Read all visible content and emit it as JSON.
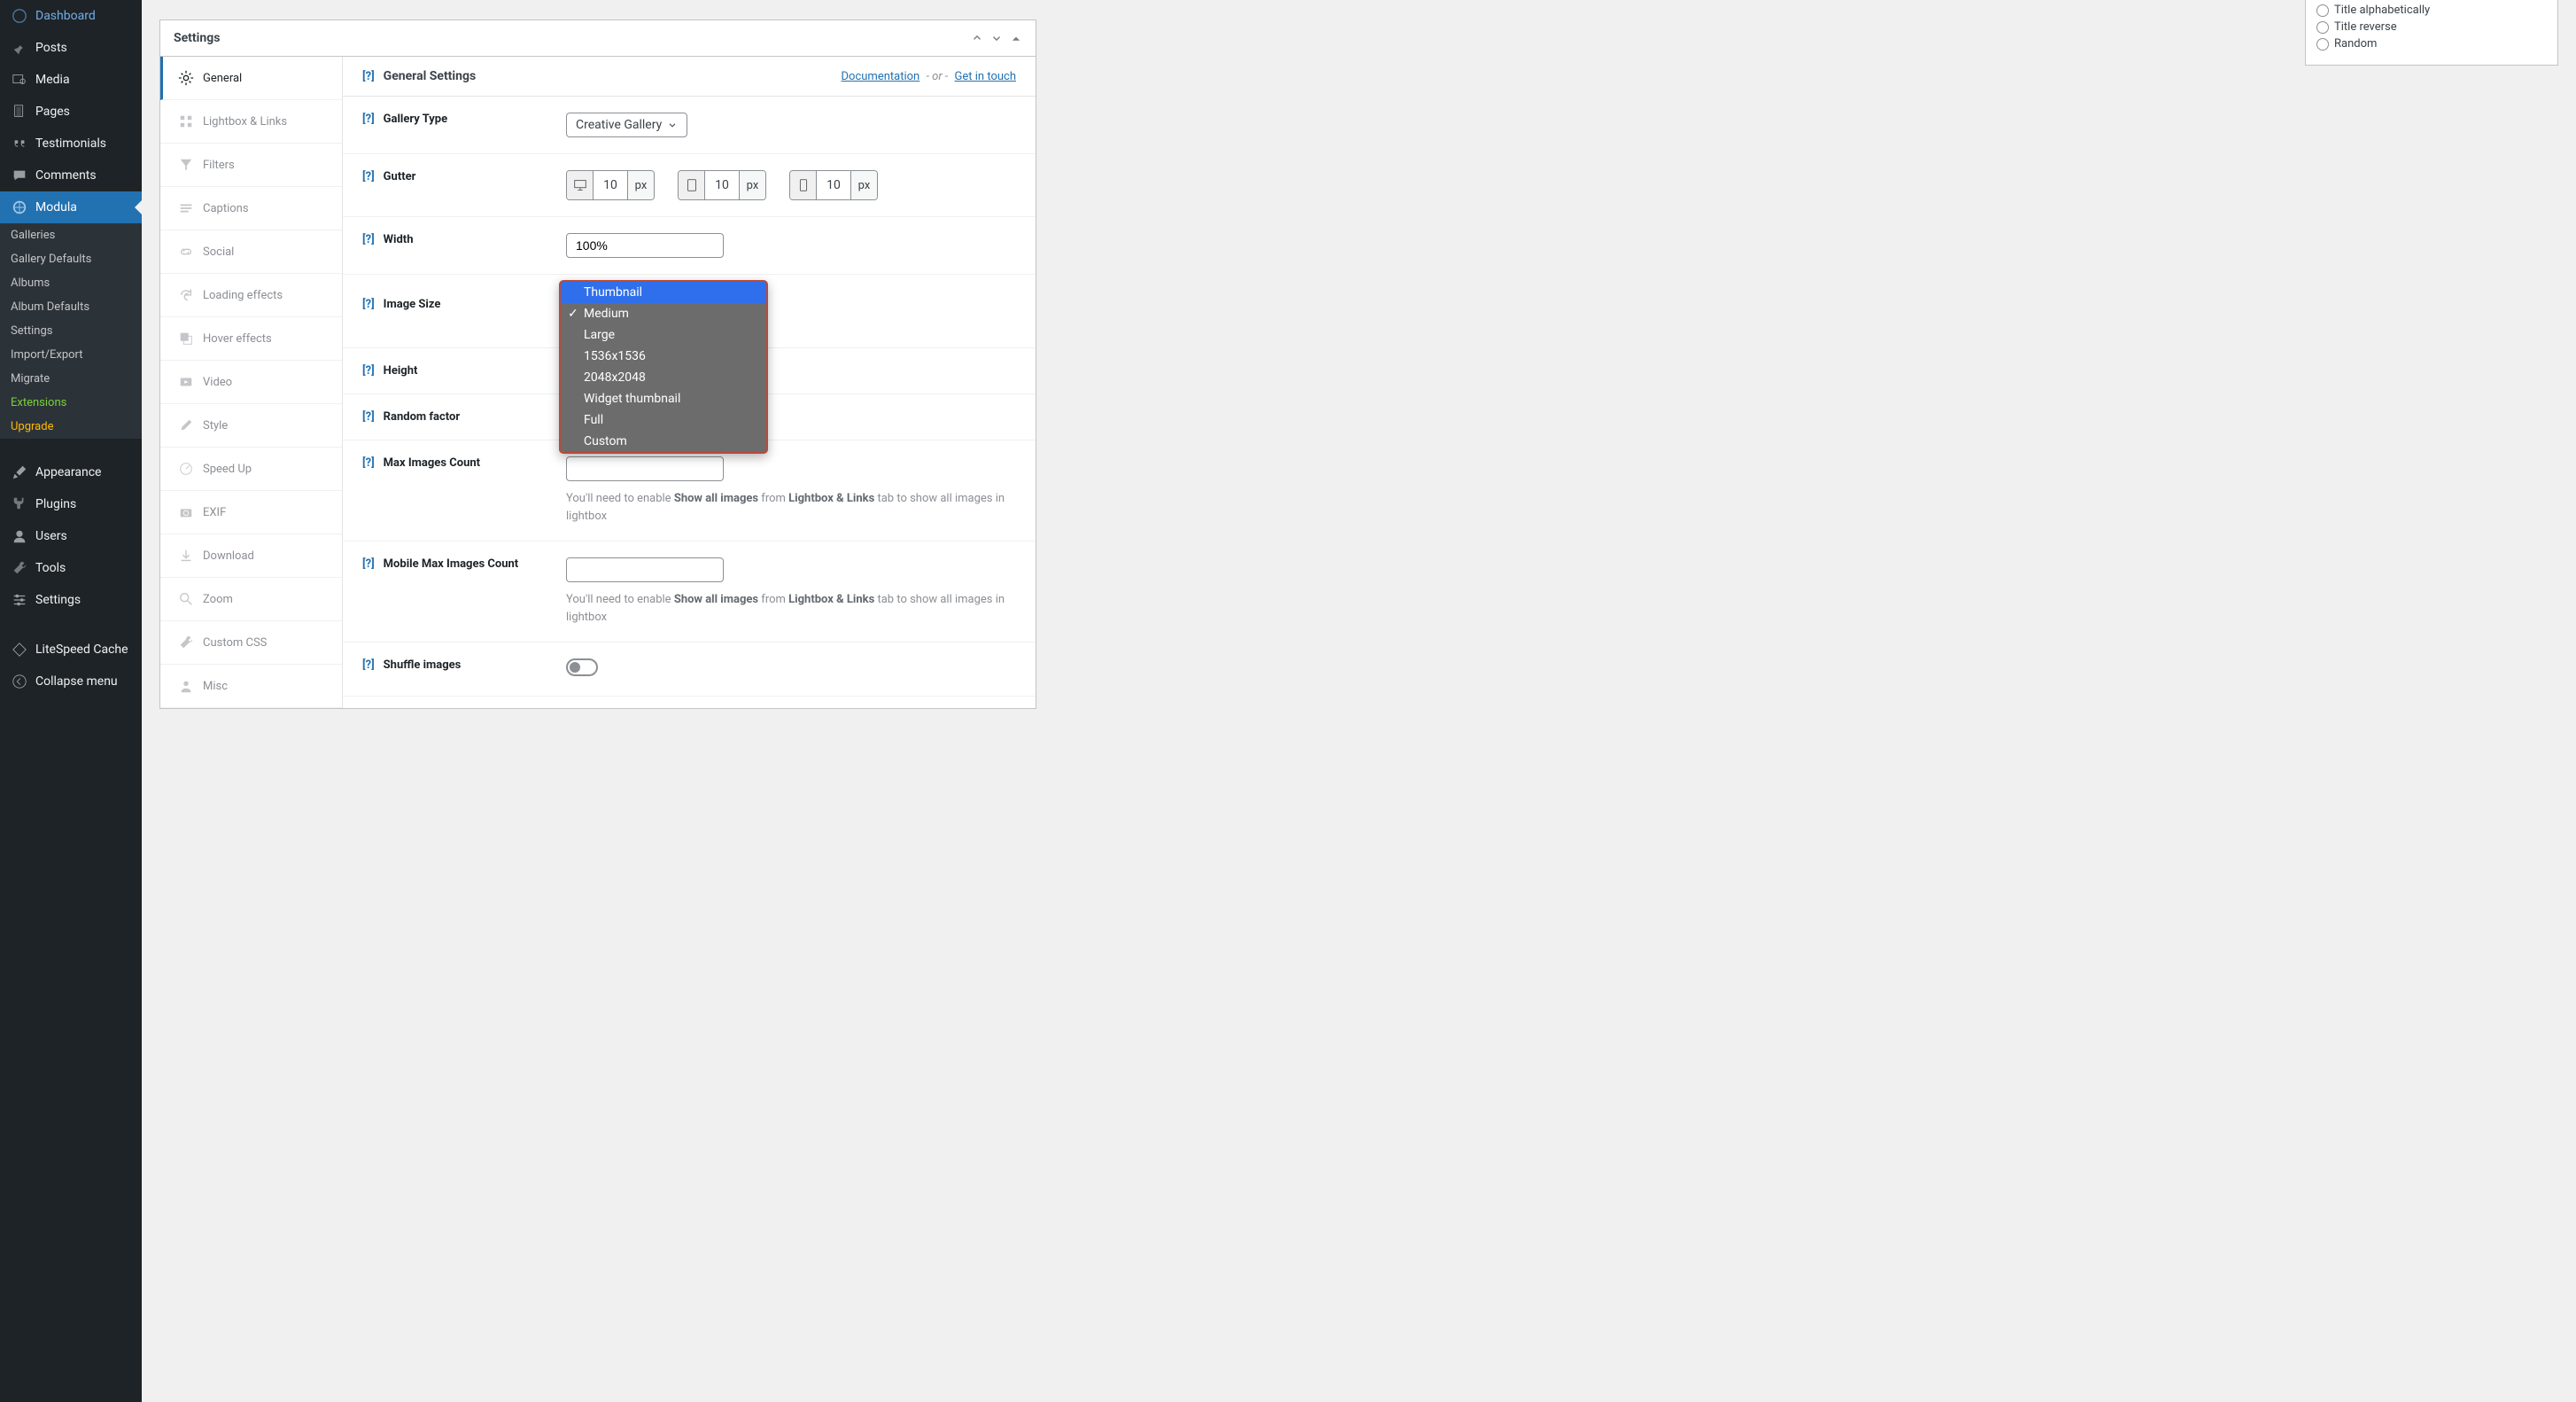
{
  "sidebar": {
    "items": [
      {
        "label": "Dashboard"
      },
      {
        "label": "Posts"
      },
      {
        "label": "Media"
      },
      {
        "label": "Pages"
      },
      {
        "label": "Testimonials"
      },
      {
        "label": "Comments"
      },
      {
        "label": "Modula"
      },
      {
        "label": "Appearance"
      },
      {
        "label": "Plugins"
      },
      {
        "label": "Users"
      },
      {
        "label": "Tools"
      },
      {
        "label": "Settings"
      },
      {
        "label": "LiteSpeed Cache"
      },
      {
        "label": "Collapse menu"
      }
    ],
    "sub": {
      "galleries": "Galleries",
      "gallery_defaults": "Gallery Defaults",
      "albums": "Albums",
      "album_defaults": "Album Defaults",
      "settings": "Settings",
      "import_export": "Import/Export",
      "migrate": "Migrate",
      "extensions": "Extensions",
      "upgrade": "Upgrade"
    }
  },
  "panel": {
    "title": "Settings",
    "tabs": [
      "General",
      "Lightbox & Links",
      "Filters",
      "Captions",
      "Social",
      "Loading effects",
      "Hover effects",
      "Video",
      "Style",
      "Speed Up",
      "EXIF",
      "Download",
      "Zoom",
      "Custom CSS",
      "Misc"
    ],
    "section_title": "General Settings",
    "doc": "Documentation",
    "or": "- or -",
    "contact": "Get in touch",
    "help": "[?]"
  },
  "fields": {
    "gallery_type": {
      "label": "Gallery Type",
      "value": "Creative Gallery"
    },
    "gutter": {
      "label": "Gutter",
      "desktop": "10",
      "tablet": "10",
      "mobile": "10",
      "unit": "px"
    },
    "width": {
      "label": "Width",
      "value": "100%"
    },
    "image_size": {
      "label": "Image Size",
      "selected": "Medium",
      "options": [
        "Thumbnail",
        "Medium",
        "Large",
        "1536x1536",
        "2048x2048",
        "Widget thumbnail",
        "Full",
        "Custom"
      ]
    },
    "height": {
      "label": "Height"
    },
    "random_factor": {
      "label": "Random factor"
    },
    "max_images": {
      "label": "Max Images Count",
      "hint_pre": "You'll need to enable ",
      "hint_b1": "Show all images",
      "hint_mid": " from ",
      "hint_b2": "Lightbox & Links",
      "hint_post": " tab to show all images in lightbox"
    },
    "mobile_max": {
      "label": "Mobile Max Images Count",
      "hint_pre": "You'll need to enable ",
      "hint_b1": "Show all images",
      "hint_mid": " from ",
      "hint_b2": "Lightbox & Links",
      "hint_post": " tab to show all images in lightbox"
    },
    "shuffle": {
      "label": "Shuffle images"
    }
  },
  "sidebox": {
    "opts": [
      "Title alphabetically",
      "Title reverse",
      "Random"
    ]
  }
}
